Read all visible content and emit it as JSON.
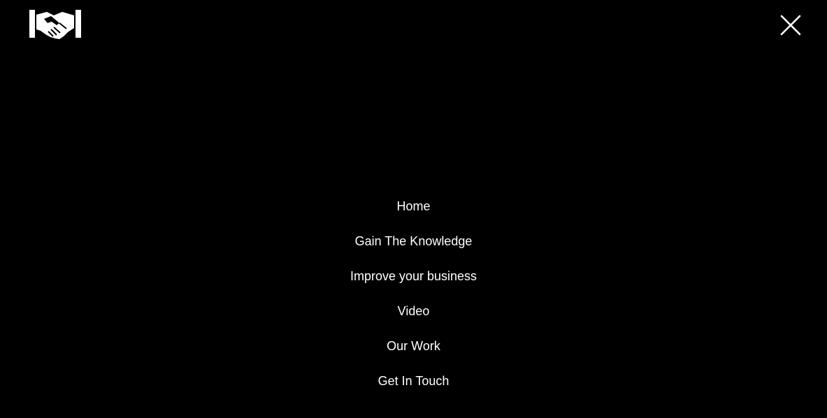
{
  "header": {
    "logo_icon": "handshake-icon",
    "close_icon": "close-icon"
  },
  "menu": {
    "items": [
      {
        "label": "Home"
      },
      {
        "label": "Gain The Knowledge"
      },
      {
        "label": "Improve your business"
      },
      {
        "label": "Video"
      },
      {
        "label": "Our Work"
      },
      {
        "label": "Get In Touch"
      }
    ]
  },
  "colors": {
    "background": "#000000",
    "foreground": "#ffffff"
  }
}
